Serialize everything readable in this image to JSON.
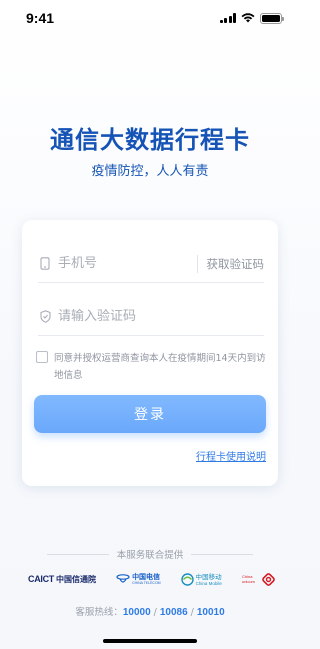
{
  "status_bar": {
    "time": "9:41"
  },
  "header": {
    "title": "通信大数据行程卡",
    "subtitle": "疫情防控，人人有责"
  },
  "form": {
    "phone_placeholder": "手机号",
    "get_code_label": "获取验证码",
    "code_placeholder": "请输入验证码",
    "agree_text": "同意并授权运营商查询本人在疫情期间14天内到访地信息",
    "login_label": "登录",
    "guide_link": "行程卡使用说明"
  },
  "providers": {
    "heading": "本服务联合提供",
    "caict": {
      "mark": "CAICT",
      "name": "中国信通院"
    },
    "telecom": {
      "cn": "中国电信",
      "en": "CHINA TELECOM"
    },
    "mobile": {
      "cn": "中国移动",
      "en": "China Mobile"
    },
    "unicom": {
      "en": "China unicom"
    }
  },
  "hotline": {
    "label": "客服热线：",
    "numbers": [
      "10000",
      "10086",
      "10010"
    ],
    "separator": "/"
  },
  "colors": {
    "brand": "#1554b6",
    "button": "#6aa8fb",
    "link": "#2f7be6"
  }
}
